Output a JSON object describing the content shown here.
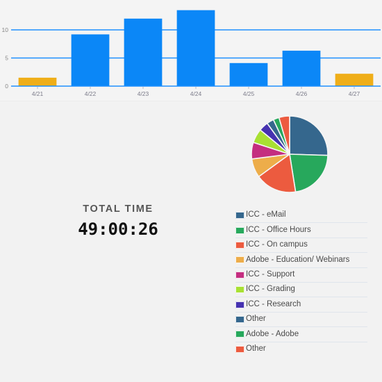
{
  "total": {
    "label": "TOTAL TIME",
    "value": "49:00:26"
  },
  "colors": {
    "bar_blue": "#0b87f7",
    "bar_orange": "#efae18",
    "gridline": "#1e90ff",
    "panel_bg": "#f4f4f4",
    "page_bg": "#f2f2f2"
  },
  "legend": {
    "items": [
      {
        "label": "ICC - eMail",
        "color": "#35678d"
      },
      {
        "label": "ICC - Office Hours",
        "color": "#27a85c"
      },
      {
        "label": "ICC - On campus",
        "color": "#ec5b3f"
      },
      {
        "label": "Adobe - Education/ Webinars",
        "color": "#edad4a"
      },
      {
        "label": "ICC - Support",
        "color": "#c42e80"
      },
      {
        "label": "ICC - Grading",
        "color": "#a8e033"
      },
      {
        "label": "ICC - Research",
        "color": "#4632b0"
      },
      {
        "label": "Other",
        "color": "#35678d"
      },
      {
        "label": "Adobe - Adobe",
        "color": "#27a85c"
      },
      {
        "label": "Other",
        "color": "#ec5b3f"
      }
    ]
  },
  "chart_data": [
    {
      "type": "bar",
      "title": "",
      "xlabel": "",
      "ylabel": "",
      "categories": [
        "4/21",
        "4/22",
        "4/23",
        "4/24",
        "4/25",
        "4/26",
        "4/27"
      ],
      "values": [
        1.5,
        9.2,
        12.0,
        13.5,
        4.1,
        6.3,
        2.2
      ],
      "colors": [
        "#efae18",
        "#0b87f7",
        "#0b87f7",
        "#0b87f7",
        "#0b87f7",
        "#0b87f7",
        "#efae18"
      ],
      "ylim": [
        0,
        13.8
      ],
      "yticks": [
        0,
        5,
        10
      ],
      "ytick_labels": [
        "0",
        "5",
        "10"
      ],
      "grid": true
    },
    {
      "type": "pie",
      "title": "",
      "labels": [
        "ICC - eMail",
        "ICC - Office Hours",
        "ICC - On campus",
        "Adobe - Education/ Webinars",
        "ICC - Support",
        "ICC - Grading",
        "ICC - Research",
        "Other",
        "Adobe - Adobe",
        "Other"
      ],
      "values": [
        25.5,
        22.0,
        17.5,
        8.0,
        7.0,
        6.0,
        4.0,
        3.0,
        2.5,
        4.5
      ],
      "colors": [
        "#35678d",
        "#27a85c",
        "#ec5b3f",
        "#edad4a",
        "#c42e80",
        "#a8e033",
        "#4632b0",
        "#35678d",
        "#27a85c",
        "#ec5b3f"
      ],
      "legend_position": "below"
    }
  ]
}
